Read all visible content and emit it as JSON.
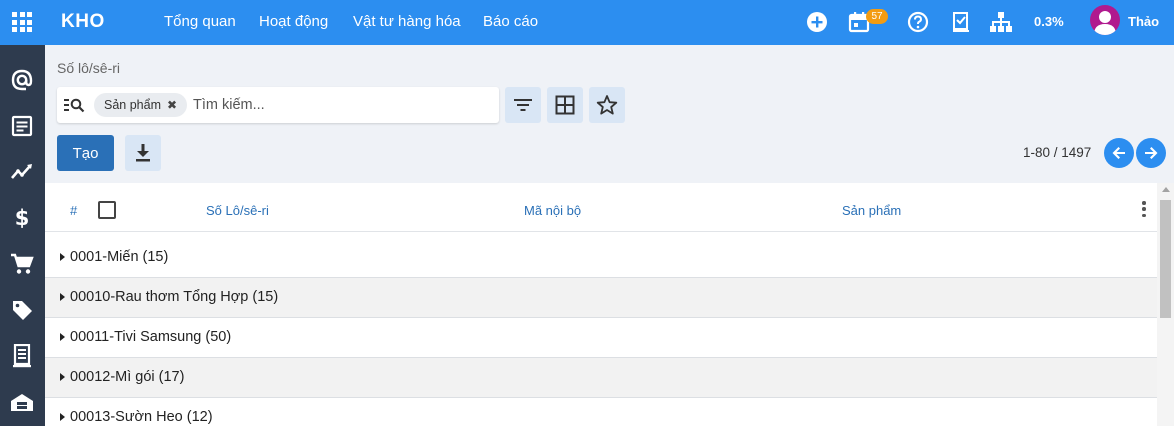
{
  "topbar": {
    "brand": "KHO",
    "menu": [
      "Tổng quan",
      "Hoạt động",
      "Vật tư hàng hóa",
      "Báo cáo"
    ],
    "activity_count": "57",
    "progress_text": "0.3%",
    "user_name": "Thảo",
    "icons": [
      "apps-icon",
      "plus-circle-icon",
      "calendar-icon",
      "help-icon",
      "checklist-icon",
      "org-chart-icon"
    ]
  },
  "sidebar": {
    "icons": [
      "at-sign-icon",
      "document-icon",
      "trend-chart-icon",
      "dollar-icon",
      "cart-icon",
      "tag-icon",
      "receipt-icon",
      "inventory-icon"
    ]
  },
  "control_panel": {
    "breadcrumb": "Số lô/sê-ri",
    "facet_label": "Sản phẩm",
    "search_placeholder": "Tìm kiếm...",
    "create_label": "Tạo",
    "pager_value": "1-80 / 1497"
  },
  "table": {
    "columns": [
      "#",
      "Số Lô/sê-ri",
      "Mã nội bộ",
      "Sản phẩm"
    ],
    "groups": [
      "0001-Miến (15)",
      "00010-Rau thơm Tổng Hợp (15)",
      "00011-Tivi Samsung (50)",
      "00012-Mì gói (17)",
      "00013-Sườn Heo (12)"
    ]
  },
  "colors": {
    "topbar": "#2c8ef0",
    "sidebar": "#2e3b4e",
    "primary_button": "#2a70b7",
    "badge": "#f39c12"
  }
}
